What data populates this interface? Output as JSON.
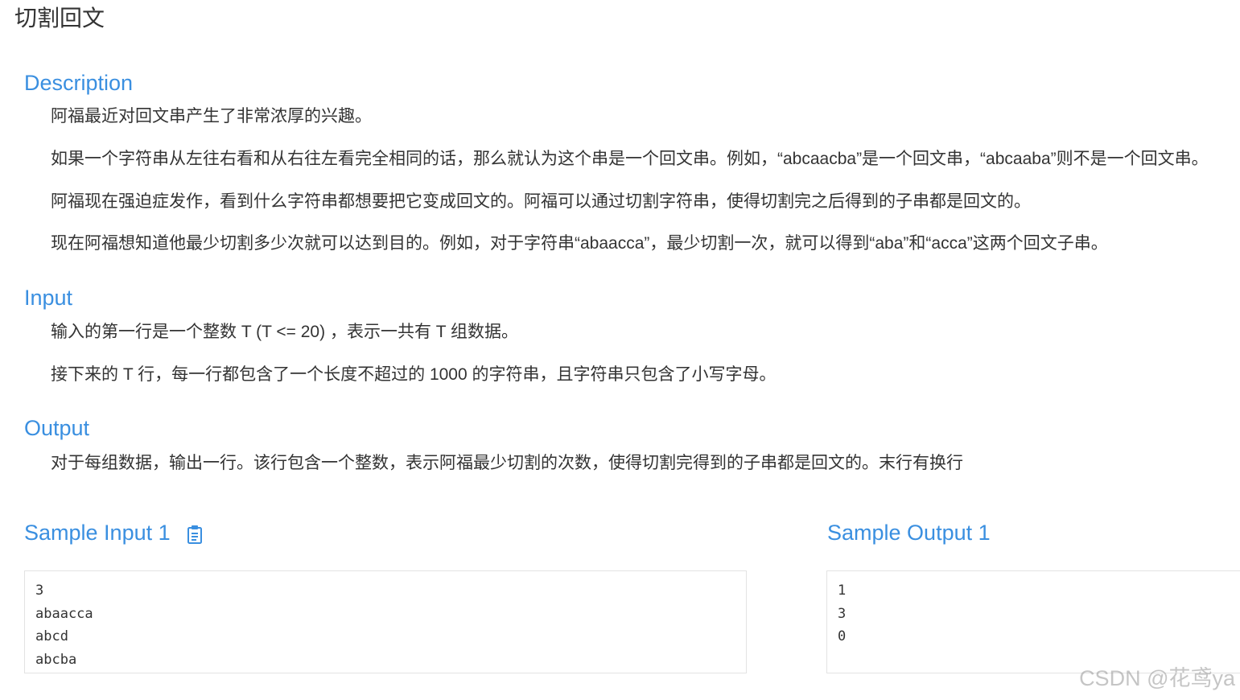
{
  "problem": {
    "title": "切割回文"
  },
  "description": {
    "heading": "Description",
    "paragraphs": [
      "阿福最近对回文串产生了非常浓厚的兴趣。",
      "如果一个字符串从左往右看和从右往左看完全相同的话，那么就认为这个串是一个回文串。例如，“abcaacba”是一个回文串，“abcaaba”则不是一个回文串。",
      "阿福现在强迫症发作，看到什么字符串都想要把它变成回文的。阿福可以通过切割字符串，使得切割完之后得到的子串都是回文的。",
      "现在阿福想知道他最少切割多少次就可以达到目的。例如，对于字符串“abaacca”，最少切割一次，就可以得到“aba”和“acca”这两个回文子串。"
    ]
  },
  "input": {
    "heading": "Input",
    "paragraphs": [
      "输入的第一行是一个整数 T (T <= 20) ，表示一共有 T 组数据。",
      "接下来的 T 行，每一行都包含了一个长度不超过的 1000 的字符串，且字符串只包含了小写字母。"
    ]
  },
  "output": {
    "heading": "Output",
    "paragraphs": [
      "对于每组数据，输出一行。该行包含一个整数，表示阿福最少切割的次数，使得切割完得到的子串都是回文的。末行有换行"
    ]
  },
  "sample_input": {
    "heading": "Sample Input 1",
    "copy_icon": "clipboard-icon",
    "lines": [
      "3",
      "abaacca",
      "abcd",
      "abcba"
    ]
  },
  "sample_output": {
    "heading": "Sample Output 1",
    "lines": [
      "1",
      "3",
      "0"
    ]
  },
  "watermark": "CSDN @花鸢ya",
  "colors": {
    "accent": "#3a8fe0",
    "text": "#333333",
    "border": "#e3e3e3"
  }
}
